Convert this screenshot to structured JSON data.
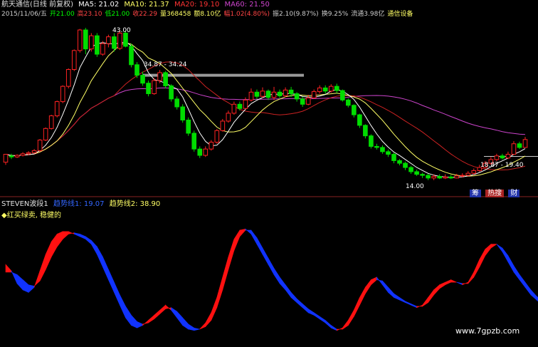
{
  "header": {
    "title": "航天通信(日线 前复权)",
    "ma": [
      {
        "label": "MA5: 21.02",
        "color": "#ffffff"
      },
      {
        "label": "MA10: 21.37",
        "color": "#ffff66"
      },
      {
        "label": "MA20: 19.10",
        "color": "#ff3333"
      },
      {
        "label": "MA60: 21.50",
        "color": "#cc44cc"
      }
    ],
    "info": [
      {
        "text": "2015/11/06/五",
        "color": "#cccccc"
      },
      {
        "text": "开21.00",
        "color": "#00ff00"
      },
      {
        "text": "高23.10",
        "color": "#ff4444"
      },
      {
        "text": "低21.00",
        "color": "#00ff00"
      },
      {
        "text": "收22.29",
        "color": "#ff4444"
      },
      {
        "text": "量368458",
        "color": "#ffff66"
      },
      {
        "text": "额8.10亿",
        "color": "#ffff66"
      },
      {
        "text": "幅1.02(4.80%)",
        "color": "#ff4444"
      },
      {
        "text": "振2.10(9.87%)",
        "color": "#cccccc"
      },
      {
        "text": "换9.25%",
        "color": "#cccccc"
      },
      {
        "text": "流通3.98亿",
        "color": "#cccccc"
      },
      {
        "text": "通信设备",
        "color": "#ffff66"
      }
    ]
  },
  "indicator_header": {
    "name": "STEVEN波段1",
    "line1": "趋势线1: 19.07",
    "line2": "趋势线2: 38.90",
    "legend": "◆红买绿卖, 稳健的"
  },
  "annotations": {
    "high": "43.00",
    "resistance": "34.87 - 34.24",
    "low": "14.00",
    "range": "18.87 - 19.40"
  },
  "toolbar": {
    "items": [
      {
        "label": "筹"
      },
      {
        "label": "热搜"
      },
      {
        "label": "财"
      }
    ]
  },
  "watermark": "www.7gpzb.com",
  "colors": {
    "up": "#ff2222",
    "down": "#00dd00",
    "ma5": "#ffffff",
    "ma10": "#ffff66",
    "ma20": "#cc2222",
    "ma60": "#cc44cc"
  },
  "chart_data": [
    {
      "type": "candlestick",
      "title": "航天通信(日线 前复权)",
      "ylim": [
        12,
        45
      ],
      "candles": [
        [
          18.0,
          19.5,
          17.5,
          19.2
        ],
        [
          19.2,
          19.0,
          18.6,
          19.6
        ],
        [
          19.0,
          19.3,
          18.8,
          19.5
        ],
        [
          19.3,
          19.6,
          19.1,
          19.9
        ],
        [
          19.6,
          19.8,
          19.3,
          20.1
        ],
        [
          19.8,
          20.2,
          19.6,
          20.5
        ],
        [
          20.2,
          22.2,
          20.0,
          22.4
        ],
        [
          22.2,
          24.4,
          22.0,
          24.6
        ],
        [
          24.4,
          26.8,
          24.2,
          27.0
        ],
        [
          26.8,
          29.5,
          26.5,
          29.7
        ],
        [
          29.5,
          32.4,
          29.2,
          32.6
        ],
        [
          32.4,
          35.6,
          32.0,
          35.8
        ],
        [
          35.6,
          39.2,
          35.3,
          39.4
        ],
        [
          39.2,
          43.1,
          38.8,
          43.3
        ],
        [
          43.1,
          39.5,
          38.5,
          43.5
        ],
        [
          39.5,
          42.0,
          39.0,
          42.5
        ],
        [
          42.0,
          38.5,
          38.0,
          42.5
        ],
        [
          38.5,
          40.5,
          38.2,
          41.0
        ],
        [
          40.5,
          41.8,
          39.8,
          42.2
        ],
        [
          41.8,
          39.6,
          39.0,
          42.5
        ],
        [
          39.6,
          42.5,
          39.3,
          43.0
        ],
        [
          42.5,
          40.0,
          39.8,
          43.0
        ],
        [
          40.0,
          36.5,
          36.0,
          40.5
        ],
        [
          36.5,
          34.5,
          34.0,
          37.0
        ],
        [
          34.5,
          33.0,
          32.5,
          35.2
        ],
        [
          33.0,
          31.0,
          30.5,
          33.5
        ],
        [
          31.0,
          33.5,
          30.8,
          34.0
        ],
        [
          33.5,
          35.0,
          33.0,
          35.5
        ],
        [
          35.0,
          32.5,
          32.0,
          35.3
        ],
        [
          32.5,
          30.0,
          29.5,
          32.8
        ],
        [
          30.0,
          28.5,
          28.0,
          30.5
        ],
        [
          28.5,
          26.0,
          25.5,
          29.0
        ],
        [
          26.0,
          23.5,
          23.0,
          26.5
        ],
        [
          23.5,
          20.5,
          20.0,
          24.0
        ],
        [
          20.5,
          19.3,
          18.8,
          21.0
        ],
        [
          19.3,
          20.5,
          19.0,
          21.0
        ],
        [
          20.5,
          21.8,
          20.2,
          22.2
        ],
        [
          21.8,
          24.0,
          21.5,
          24.3
        ],
        [
          24.0,
          25.8,
          23.8,
          26.2
        ],
        [
          25.8,
          27.3,
          25.5,
          27.8
        ],
        [
          27.3,
          29.0,
          27.0,
          29.5
        ],
        [
          29.0,
          28.2,
          27.8,
          29.5
        ],
        [
          28.2,
          29.8,
          28.0,
          30.3
        ],
        [
          29.8,
          31.3,
          29.5,
          32.0
        ],
        [
          31.3,
          30.5,
          30.0,
          31.8
        ],
        [
          30.5,
          31.5,
          30.2,
          32.2
        ],
        [
          31.5,
          30.3,
          29.8,
          31.8
        ],
        [
          30.3,
          31.3,
          29.8,
          32.3
        ],
        [
          31.3,
          30.6,
          30.2,
          31.8
        ],
        [
          30.6,
          31.7,
          30.3,
          32.2
        ],
        [
          31.7,
          31.0,
          30.4,
          32.3
        ],
        [
          31.0,
          30.0,
          29.5,
          31.3
        ],
        [
          30.0,
          29.0,
          28.5,
          30.4
        ],
        [
          29.0,
          30.2,
          28.8,
          30.8
        ],
        [
          30.2,
          31.4,
          30.0,
          31.8
        ],
        [
          31.4,
          32.1,
          31.0,
          32.6
        ],
        [
          32.1,
          31.5,
          31.0,
          32.6
        ],
        [
          31.5,
          32.4,
          31.2,
          32.8
        ],
        [
          32.4,
          31.6,
          31.1,
          32.9
        ],
        [
          31.6,
          29.8,
          29.5,
          31.8
        ],
        [
          29.8,
          28.8,
          28.4,
          30.1
        ],
        [
          28.8,
          27.0,
          26.5,
          29.0
        ],
        [
          27.0,
          25.0,
          24.5,
          27.2
        ],
        [
          25.0,
          23.0,
          22.5,
          25.2
        ],
        [
          23.0,
          21.0,
          20.6,
          23.3
        ],
        [
          21.0,
          20.8,
          20.4,
          21.5
        ],
        [
          20.8,
          20.0,
          19.6,
          21.2
        ],
        [
          20.0,
          19.5,
          19.0,
          20.4
        ],
        [
          19.5,
          18.3,
          17.8,
          19.8
        ],
        [
          18.3,
          17.8,
          17.4,
          18.6
        ],
        [
          17.8,
          17.0,
          16.5,
          18.1
        ],
        [
          17.0,
          16.2,
          15.8,
          17.3
        ],
        [
          16.2,
          15.7,
          15.4,
          16.6
        ],
        [
          15.7,
          15.5,
          15.0,
          16.0
        ],
        [
          15.5,
          15.0,
          14.6,
          15.8
        ],
        [
          15.0,
          15.3,
          14.6,
          15.7
        ],
        [
          15.3,
          15.0,
          14.8,
          15.7
        ],
        [
          15.0,
          15.2,
          14.8,
          15.7
        ],
        [
          15.2,
          15.0,
          14.8,
          15.6
        ],
        [
          15.0,
          15.4,
          14.9,
          15.8
        ],
        [
          15.4,
          15.5,
          15.1,
          15.9
        ],
        [
          15.5,
          15.9,
          15.3,
          16.3
        ],
        [
          15.9,
          16.4,
          15.6,
          16.8
        ],
        [
          16.4,
          17.0,
          16.2,
          17.5
        ],
        [
          17.0,
          17.8,
          16.8,
          18.2
        ],
        [
          17.8,
          18.5,
          17.5,
          19.0
        ],
        [
          18.5,
          19.2,
          18.2,
          19.6
        ],
        [
          19.2,
          18.8,
          18.5,
          19.6
        ],
        [
          18.8,
          19.5,
          18.6,
          20.0
        ],
        [
          19.5,
          21.5,
          19.4,
          22.0
        ],
        [
          21.5,
          20.8,
          20.5,
          21.9
        ],
        [
          20.8,
          22.3,
          20.7,
          22.8
        ]
      ]
    },
    {
      "type": "area",
      "title": "STEVEN波段1",
      "ylim": [
        0,
        100
      ],
      "series": [
        {
          "name": "趋势线1",
          "values": [
            60,
            55,
            45,
            40,
            38,
            42,
            55,
            68,
            78,
            84,
            86,
            86,
            84,
            82,
            80,
            76,
            68,
            58,
            48,
            38,
            28,
            18,
            12,
            10,
            12,
            16,
            20,
            24,
            28,
            24,
            18,
            12,
            9,
            8,
            9,
            14,
            22,
            34,
            50,
            66,
            80,
            87,
            88,
            84,
            76,
            68,
            60,
            52,
            45,
            40,
            34,
            30,
            26,
            22,
            20,
            17,
            14,
            10,
            8,
            10,
            16,
            24,
            34,
            42,
            48,
            50,
            44,
            38,
            34,
            32,
            30,
            28,
            26,
            28,
            34,
            40,
            44,
            46,
            48,
            46,
            44,
            46,
            54,
            64,
            72,
            76,
            76,
            70,
            62,
            54,
            48,
            42,
            36,
            32,
            28,
            30,
            34,
            40
          ]
        },
        {
          "name": "趋势线2",
          "values": [
            54,
            54,
            52,
            48,
            44,
            43,
            47,
            56,
            66,
            74,
            80,
            84,
            85,
            84,
            82,
            79,
            74,
            66,
            56,
            46,
            36,
            27,
            20,
            15,
            13,
            14,
            17,
            21,
            25,
            26,
            23,
            18,
            13,
            10,
            9,
            11,
            16,
            26,
            40,
            56,
            71,
            82,
            87,
            87,
            81,
            73,
            65,
            57,
            50,
            44,
            38,
            33,
            29,
            25,
            22,
            19,
            16,
            12,
            9,
            9,
            12,
            19,
            28,
            37,
            44,
            48,
            47,
            42,
            37,
            34,
            31,
            29,
            27,
            27,
            30,
            36,
            41,
            44,
            46,
            46,
            45,
            45,
            50,
            58,
            67,
            73,
            76,
            73,
            67,
            59,
            52,
            46,
            40,
            35,
            31,
            30,
            32,
            36
          ]
        }
      ]
    }
  ]
}
